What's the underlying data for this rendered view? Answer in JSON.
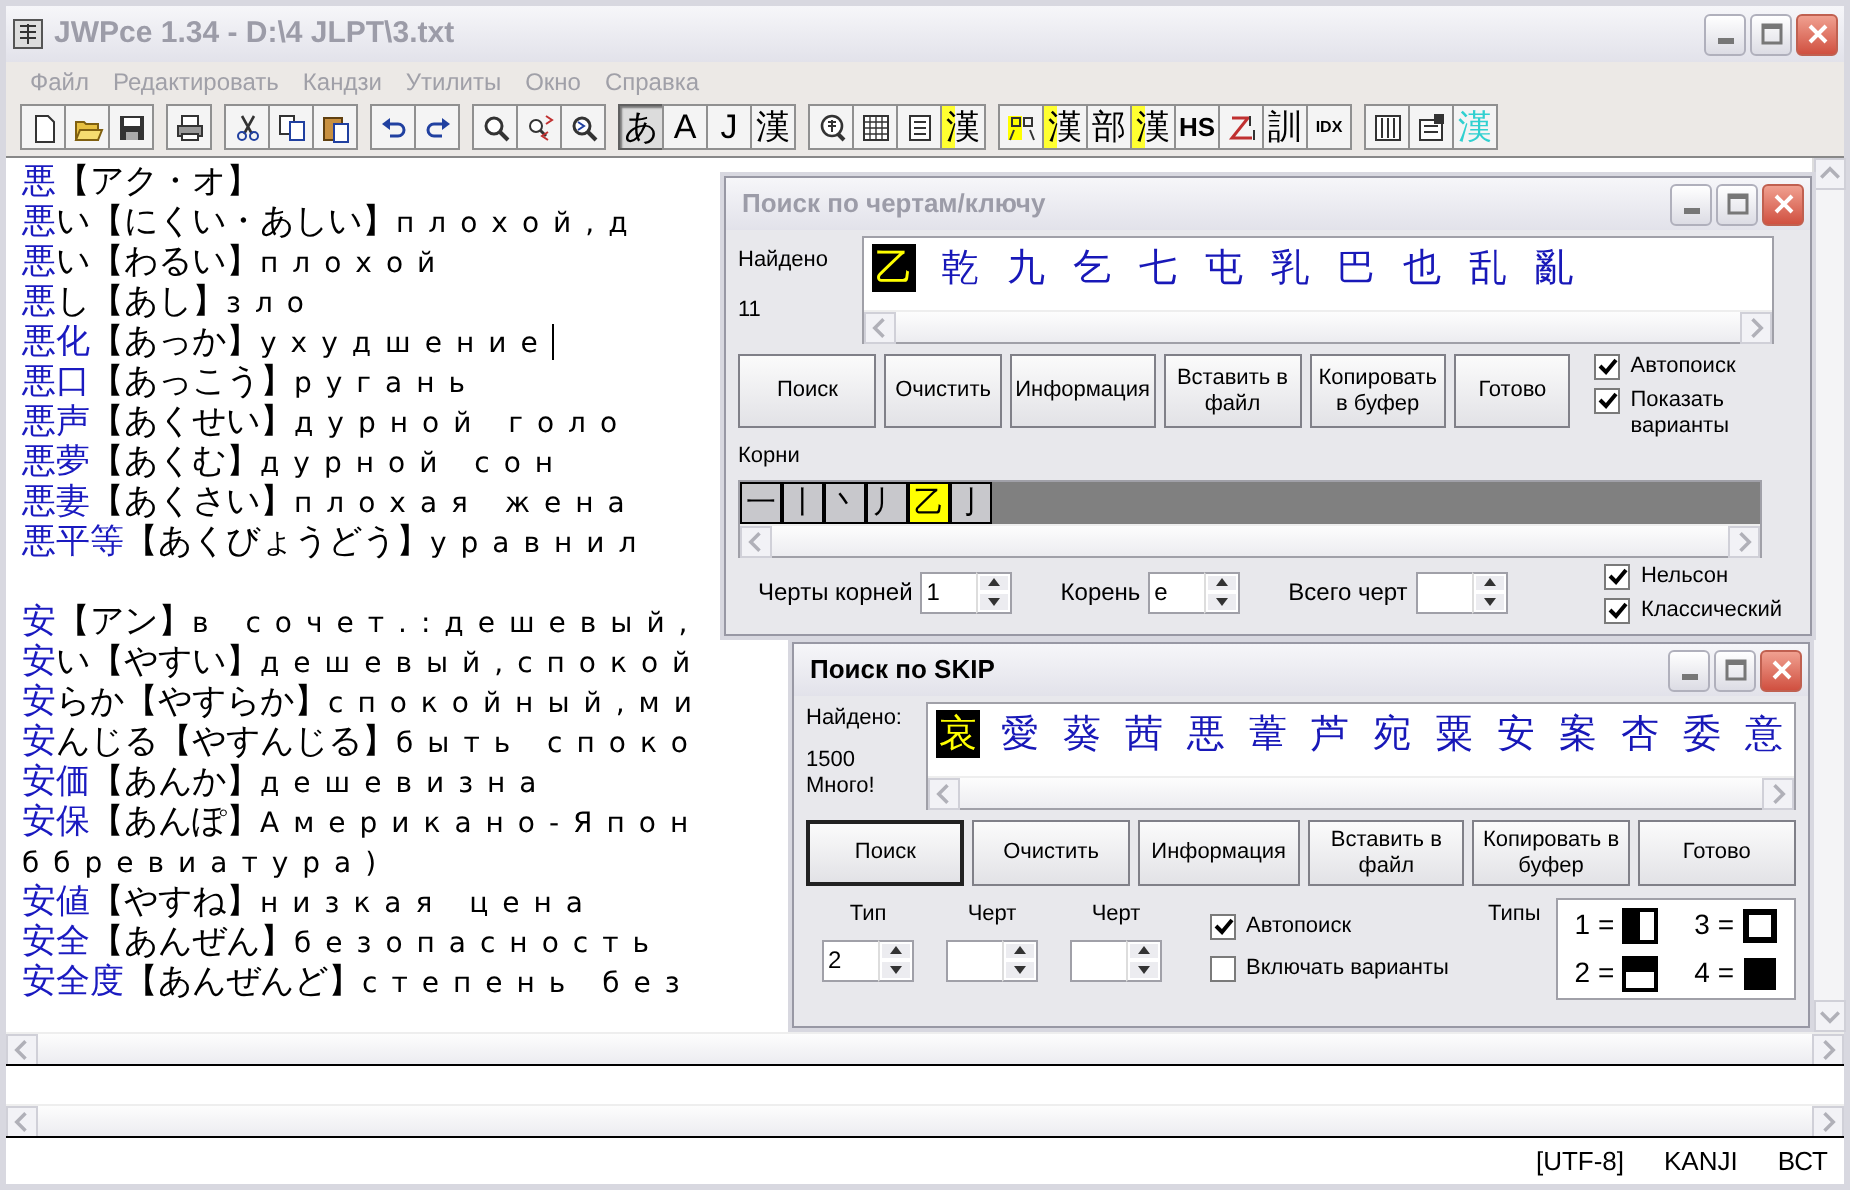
{
  "window": {
    "title": "JWPce 1.34 - D:\\4 JLPT\\3.txt",
    "active": false
  },
  "menu": [
    "Файл",
    "Редактировать",
    "Кандзи",
    "Утилиты",
    "Окно",
    "Справка"
  ],
  "toolbar": [
    [
      {
        "kind": "icon"
      },
      {
        "kind": "icon"
      },
      {
        "kind": "icon"
      }
    ],
    [
      {
        "kind": "icon"
      }
    ],
    [
      {
        "kind": "icon"
      },
      {
        "kind": "icon"
      },
      {
        "kind": "icon"
      }
    ],
    [
      {
        "kind": "icon"
      },
      {
        "kind": "icon"
      }
    ],
    [
      {
        "kind": "icon"
      },
      {
        "kind": "icon"
      },
      {
        "kind": "icon"
      }
    ],
    [
      {
        "kind": "glyph",
        "text": "あ",
        "pressed": true
      },
      {
        "kind": "glyph",
        "text": "A",
        "pressed": false
      },
      {
        "kind": "glyph",
        "text": "J",
        "pressed": false
      },
      {
        "kind": "glyph",
        "text": "漢",
        "pressed": false
      }
    ],
    [
      {
        "kind": "icon"
      },
      {
        "kind": "icon"
      },
      {
        "kind": "icon"
      },
      {
        "kind": "marked",
        "text": "漢"
      }
    ],
    [
      {
        "kind": "icon"
      },
      {
        "kind": "marked",
        "text": "漢"
      },
      {
        "kind": "glyph",
        "text": "部"
      },
      {
        "kind": "marked",
        "text": "漢"
      },
      {
        "kind": "bold",
        "text": "HS"
      },
      {
        "kind": "icon"
      },
      {
        "kind": "glyph",
        "text": "訓"
      },
      {
        "kind": "small",
        "text": "IDX"
      }
    ],
    [
      {
        "kind": "icon"
      },
      {
        "kind": "icon"
      },
      {
        "kind": "tinted",
        "text": "漢"
      }
    ]
  ],
  "entries": [
    {
      "kind": "entry",
      "headword": "悪",
      "text": "【アク・オ】",
      "cursor": false
    },
    {
      "kind": "entry",
      "headword": "悪",
      "text": "い【にくい・あしい】плохой,д",
      "cursor": false
    },
    {
      "kind": "entry",
      "headword": "悪",
      "text": "い【わるい】плохой",
      "cursor": false
    },
    {
      "kind": "entry",
      "headword": "悪",
      "text": "し【あし】зло",
      "cursor": false
    },
    {
      "kind": "entry",
      "headword": "悪化",
      "text": "【あっか】ухудшение",
      "cursor": true
    },
    {
      "kind": "entry",
      "headword": "悪口",
      "text": "【あっこう】ругань",
      "cursor": false
    },
    {
      "kind": "entry",
      "headword": "悪声",
      "text": "【あくせい】дурной голо",
      "cursor": false
    },
    {
      "kind": "entry",
      "headword": "悪夢",
      "text": "【あくむ】дурной сон",
      "cursor": false
    },
    {
      "kind": "entry",
      "headword": "悪妻",
      "text": "【あくさい】плохая жена",
      "cursor": false
    },
    {
      "kind": "entry",
      "headword": "悪平等",
      "text": "【あくびょうどう】уравнил",
      "cursor": false
    },
    {
      "kind": "blank"
    },
    {
      "kind": "entry",
      "headword": "安",
      "text": "【アン】в сочет.:дешевый,",
      "cursor": false
    },
    {
      "kind": "entry",
      "headword": "安",
      "text": "い【やすい】дешевый,спокой",
      "cursor": false
    },
    {
      "kind": "entry",
      "headword": "安",
      "text": "らか【やすらか】спокойный,ми",
      "cursor": false
    },
    {
      "kind": "entry",
      "headword": "安",
      "text": "んじる【やすんじる】быть споко",
      "cursor": false
    },
    {
      "kind": "entry",
      "headword": "安価",
      "text": "【あんか】дешевизна",
      "cursor": false
    },
    {
      "kind": "entry",
      "headword": "安保",
      "text": "【あんぽ】Американо-Япон",
      "cursor": false
    },
    {
      "kind": "continuation",
      "text": "ббревиатура)",
      "cursor": false
    },
    {
      "kind": "entry",
      "headword": "安値",
      "text": "【やすね】низкая цена",
      "cursor": false
    },
    {
      "kind": "entry",
      "headword": "安全",
      "text": "【あんぜん】безопасность",
      "cursor": false
    },
    {
      "kind": "entry",
      "headword": "安全度",
      "text": "【あんぜんど】степень без",
      "cursor": false
    }
  ],
  "status_bar": [
    "[UTF-8]",
    "KANJI",
    "ВСТ"
  ],
  "radical_dialog": {
    "title": "Поиск по чертам/ключу",
    "active": false,
    "found_label": "Найдено",
    "found_count": "11",
    "results": [
      {
        "text": "乙",
        "selected": true
      },
      {
        "text": "乾",
        "selected": false
      },
      {
        "text": "九",
        "selected": false
      },
      {
        "text": "乞",
        "selected": false
      },
      {
        "text": "七",
        "selected": false
      },
      {
        "text": "屯",
        "selected": false
      },
      {
        "text": "乳",
        "selected": false
      },
      {
        "text": "巴",
        "selected": false
      },
      {
        "text": "也",
        "selected": false
      },
      {
        "text": "乱",
        "selected": false
      },
      {
        "text": "亂",
        "selected": false
      }
    ],
    "buttons": [
      {
        "label": "Поиск",
        "default": false
      },
      {
        "label": "Очистить",
        "default": false
      },
      {
        "label": "Информация",
        "default": false
      },
      {
        "label": "Вставить в файл",
        "default": false
      },
      {
        "label": "Копировать в буфер",
        "default": false
      },
      {
        "label": "Готово",
        "default": false
      }
    ],
    "options": [
      {
        "label": "Автопоиск",
        "checked": true
      },
      {
        "label": "Показать варианты",
        "checked": true
      }
    ],
    "radicals_label": "Корни",
    "radicals": [
      {
        "text": "一",
        "selected": false
      },
      {
        "text": "丨",
        "selected": false
      },
      {
        "text": "丶",
        "selected": false
      },
      {
        "text": "丿",
        "selected": false
      },
      {
        "text": "乙",
        "selected": true
      },
      {
        "text": "亅",
        "selected": false
      }
    ],
    "spinners": [
      {
        "label": "Черты корней",
        "value": "1"
      },
      {
        "label": "Корень",
        "value": "e"
      },
      {
        "label": "Всего черт"
      }
    ],
    "dictionaries": [
      {
        "label": "Нельсон",
        "checked": true
      },
      {
        "label": "Классический",
        "checked": true
      }
    ]
  },
  "skip_dialog": {
    "title": "Поиск по SKIP",
    "active": true,
    "found_label": "Найдено:",
    "found_count": "1500",
    "found_note": "Много!",
    "results": [
      {
        "text": "哀",
        "selected": true
      },
      {
        "text": "愛",
        "selected": false
      },
      {
        "text": "葵",
        "selected": false
      },
      {
        "text": "茜",
        "selected": false
      },
      {
        "text": "悪",
        "selected": false
      },
      {
        "text": "葦",
        "selected": false
      },
      {
        "text": "芦",
        "selected": false
      },
      {
        "text": "宛",
        "selected": false
      },
      {
        "text": "粟",
        "selected": false
      },
      {
        "text": "安",
        "selected": false
      },
      {
        "text": "案",
        "selected": false
      },
      {
        "text": "杏",
        "selected": false
      },
      {
        "text": "委",
        "selected": false
      },
      {
        "text": "意",
        "selected": false
      }
    ],
    "buttons": [
      {
        "label": "Поиск",
        "default": true
      },
      {
        "label": "Очистить",
        "default": false
      },
      {
        "label": "Информация",
        "default": false
      },
      {
        "label": "Вставить в файл",
        "default": false
      },
      {
        "label": "Копировать в буфер",
        "default": false
      },
      {
        "label": "Готово",
        "default": false
      }
    ],
    "spinners": [
      {
        "label": "Тип",
        "value": "2"
      },
      {
        "label": "Черт"
      },
      {
        "label": "Черт"
      }
    ],
    "options": [
      {
        "label": "Автопоиск",
        "checked": true
      },
      {
        "label": "Включать варианты",
        "checked": false
      }
    ],
    "types_label": "Типы",
    "types": [
      {
        "text": "1 =",
        "kind": "left-right"
      },
      {
        "text": "3 =",
        "kind": "enclosure"
      },
      {
        "text": "2 =",
        "kind": "top-bottom"
      },
      {
        "text": "4 =",
        "kind": "solid"
      }
    ]
  }
}
